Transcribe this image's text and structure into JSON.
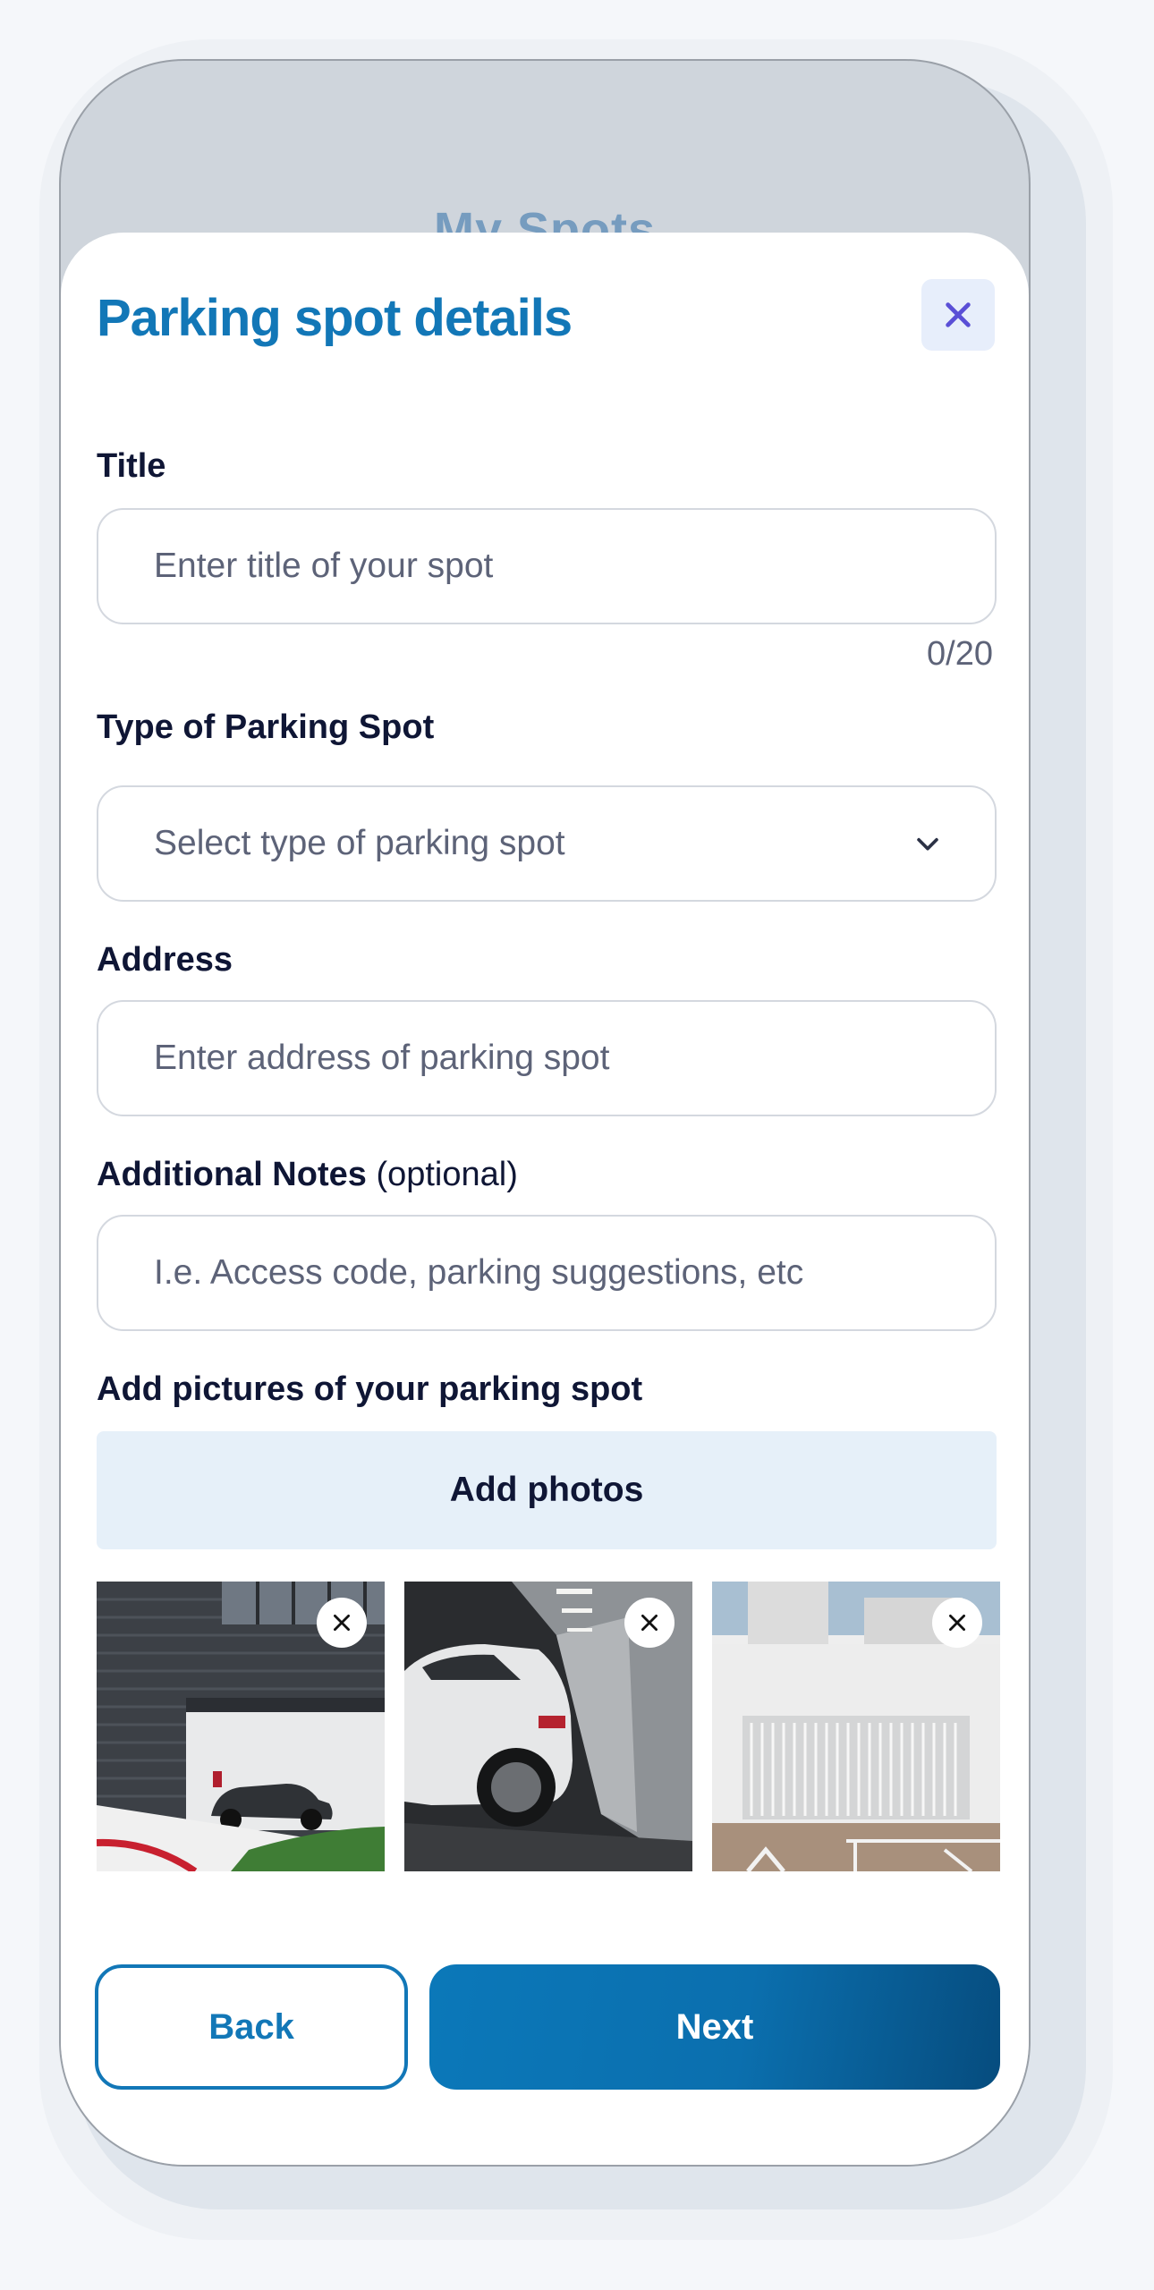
{
  "background": {
    "title": "My Spots"
  },
  "sheet": {
    "title": "Parking spot details",
    "close_icon": "close-icon"
  },
  "form": {
    "title": {
      "label": "Title",
      "placeholder": "Enter title of your spot",
      "value": "",
      "counter": "0/20"
    },
    "type": {
      "label": "Type of Parking Spot",
      "placeholder": "Select type of parking spot",
      "icon": "chevron-down-icon"
    },
    "address": {
      "label": "Address",
      "placeholder": "Enter address of parking spot",
      "value": ""
    },
    "notes": {
      "label": "Additional Notes",
      "optional": "(optional)",
      "placeholder": "I.e. Access code, parking suggestions, etc",
      "value": ""
    },
    "pictures": {
      "label": "Add pictures of your parking spot",
      "add_button": "Add photos",
      "photos": [
        {
          "name": "photo-garage-exterior",
          "remove_icon": "close-icon"
        },
        {
          "name": "photo-car-in-garage",
          "remove_icon": "close-icon"
        },
        {
          "name": "photo-gated-entrance",
          "remove_icon": "close-icon"
        }
      ]
    }
  },
  "actions": {
    "back": "Back",
    "next": "Next"
  },
  "colors": {
    "brand": "#1277b7",
    "label": "#0f1635",
    "placeholder": "#5d6378",
    "photos_bg": "#e6f0f9"
  }
}
